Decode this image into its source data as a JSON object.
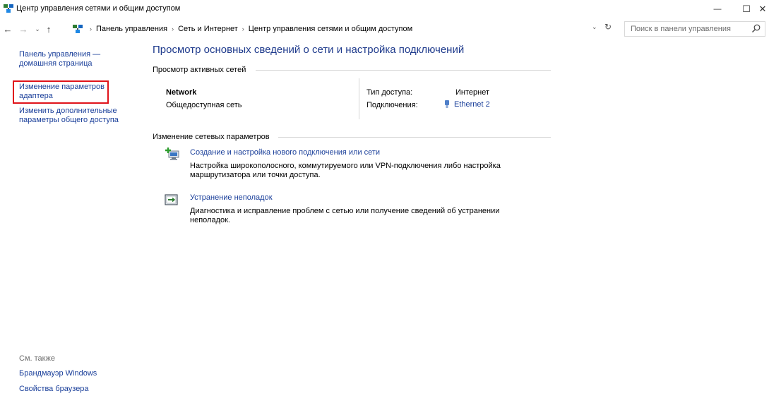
{
  "window": {
    "title": "Центр управления сетями и общим доступом",
    "minimize_glyph": "—",
    "maximize_glyph": "☐",
    "close_glyph": "✕"
  },
  "navigation": {
    "back_glyph": "←",
    "forward_glyph": "→",
    "recent_glyph": "⌄",
    "up_glyph": "↑",
    "breadcrumb_separator": "›",
    "breadcrumbs": [
      "Панель управления",
      "Сеть и Интернет",
      "Центр управления сетями и общим доступом"
    ],
    "dropdown_glyph": "⌄",
    "refresh_glyph": "↻"
  },
  "search": {
    "placeholder": "Поиск в панели управления",
    "value": ""
  },
  "sidebar": {
    "home_link": [
      "Панель управления —",
      "домашняя страница"
    ],
    "adapter_link": [
      "Изменение параметров",
      "адаптера"
    ],
    "sharing_link": [
      "Изменить дополнительные",
      "параметры общего доступа"
    ],
    "see_also_label": "См. также",
    "see_also_links": [
      "Брандмауэр Windows",
      "Свойства браузера"
    ]
  },
  "main": {
    "title": "Просмотр основных сведений о сети и настройка подключений",
    "active_networks_header": "Просмотр активных сетей",
    "network": {
      "name": "Network",
      "category": "Общедоступная сеть",
      "access_type_label": "Тип доступа:",
      "access_type_value": "Интернет",
      "connections_label": "Подключения:",
      "connections_value": "Ethernet 2"
    },
    "change_settings_header": "Изменение сетевых параметров",
    "tasks": [
      {
        "title": "Создание и настройка нового подключения или сети",
        "description": [
          "Настройка широкополосного, коммутируемого или VPN-подключения либо настройка",
          "маршрутизатора или точки доступа."
        ]
      },
      {
        "title": "Устранение неполадок",
        "description": [
          "Диагностика и исправление проблем с сетью или получение сведений об устранении",
          "неполадок."
        ]
      }
    ]
  },
  "colors": {
    "link": "#1a3f9a",
    "heading": "#1e3a8c",
    "selection_outline": "#e0131a",
    "muted_text": "#6d6d6d"
  }
}
